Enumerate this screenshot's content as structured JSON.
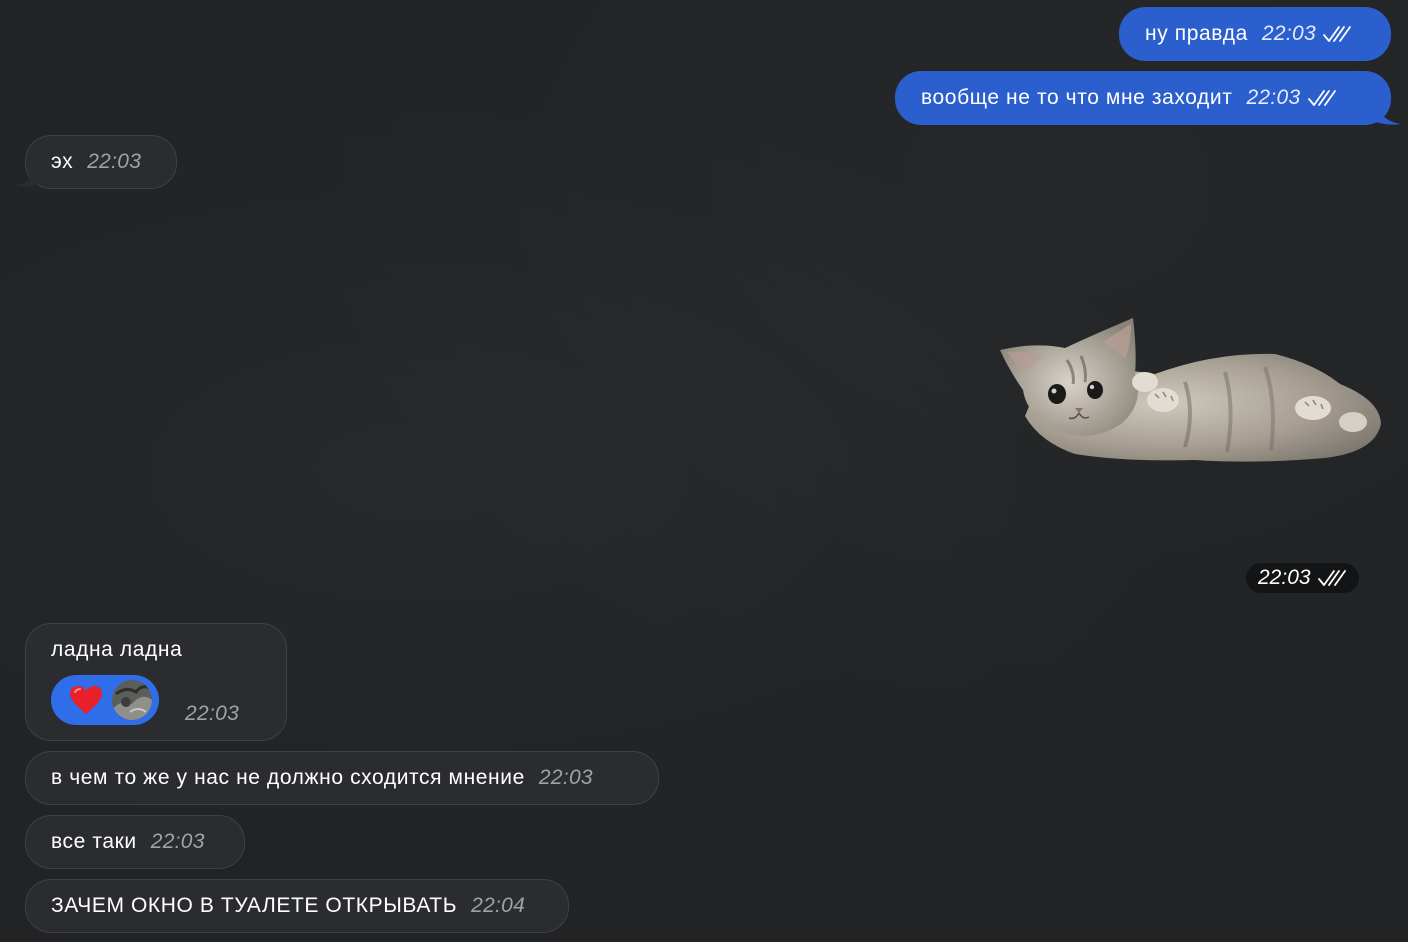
{
  "messages": [
    {
      "text": "ну правда",
      "time": "22:03"
    },
    {
      "text": "вообще не то что мне заходит",
      "time": "22:03"
    },
    {
      "text": "эх",
      "time": "22:03"
    },
    {
      "time": "22:03"
    },
    {
      "text": "ладна ладна",
      "time": "22:03"
    },
    {
      "text": "в чем то же у нас не должно сходится мнение",
      "time": "22:03"
    },
    {
      "text": "все таки",
      "time": "22:03"
    },
    {
      "text": "ЗАЧЕМ ОКНО В ТУАЛЕТЕ ОТКРЫВАТЬ",
      "time": "22:04"
    }
  ],
  "icons": {
    "read_status": "double-check-icon",
    "reaction": "red-heart-icon",
    "reactor": "avatar",
    "sticker": "kitten-sticker"
  },
  "colors": {
    "background": "#212325",
    "outgoing_bubble": "#2b5fce",
    "incoming_bubble": "#2a2c2f",
    "reaction_pill": "#2f6ee8"
  }
}
